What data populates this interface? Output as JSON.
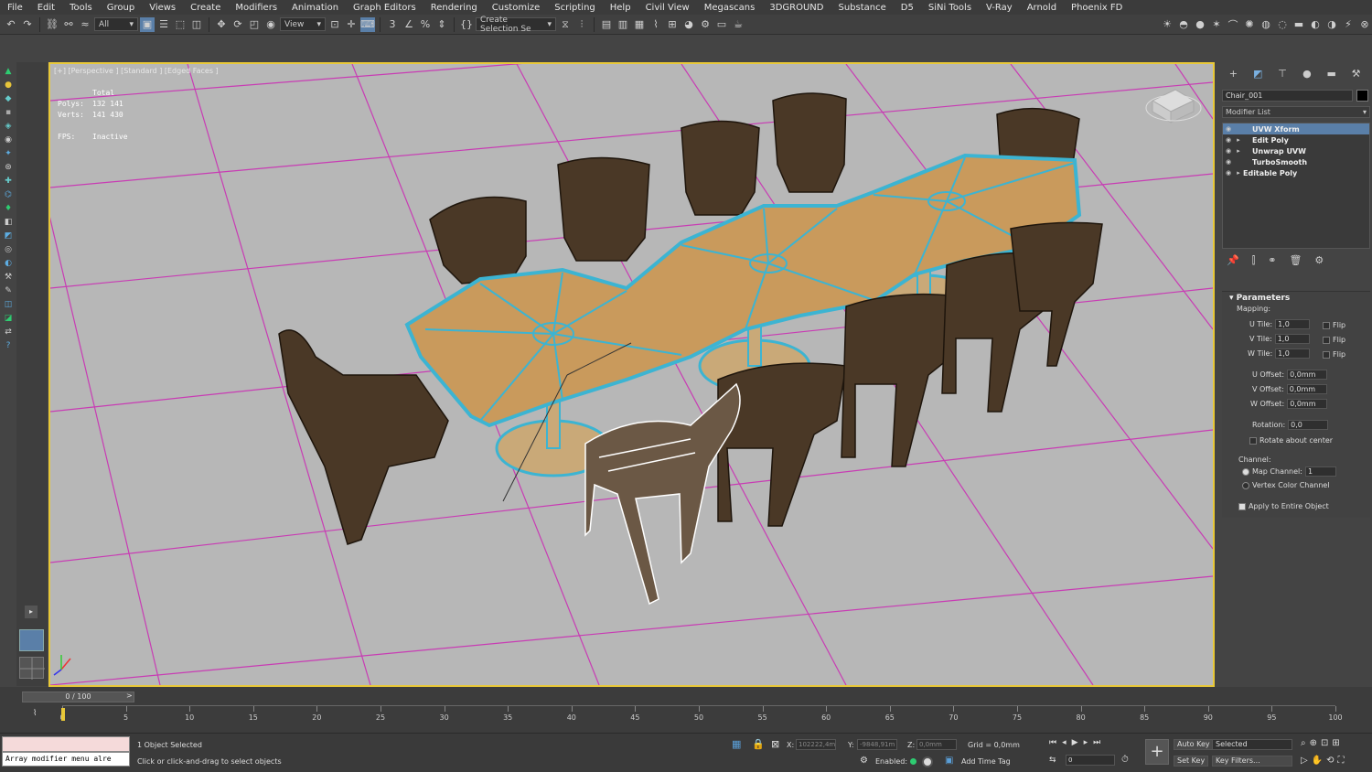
{
  "menu": [
    "File",
    "Edit",
    "Tools",
    "Group",
    "Views",
    "Create",
    "Modifiers",
    "Animation",
    "Graph Editors",
    "Rendering",
    "Customize",
    "Scripting",
    "Help",
    "Civil View",
    "Megascans",
    "3DGROUND",
    "Substance",
    "D5",
    "SiNi Tools",
    "V-Ray",
    "Arnold",
    "Phoenix FD"
  ],
  "toolbar": {
    "filter_dropdown": "All",
    "refcoord_dropdown": "View",
    "selection_set": "Create Selection Se"
  },
  "viewport": {
    "label": "[+] [Perspective ] [Standard ] [Edged Faces ]",
    "stats": [
      {
        "label": "",
        "value": "Total"
      },
      {
        "label": "Polys:",
        "value": "132 141"
      },
      {
        "label": "Verts:",
        "value": "141 430"
      }
    ],
    "fps_label": "FPS:",
    "fps_value": "Inactive"
  },
  "command_panel": {
    "object_name": "Chair_001",
    "modifier_list": "Modifier List",
    "stack": [
      {
        "label": "UVW Xform",
        "selected": true,
        "expandable": false
      },
      {
        "label": "Edit Poly",
        "selected": false,
        "expandable": true
      },
      {
        "label": "Unwrap UVW",
        "selected": false,
        "expandable": true
      },
      {
        "label": "TurboSmooth",
        "selected": false,
        "expandable": false
      },
      {
        "label": "Editable Poly",
        "selected": false,
        "expandable": true
      }
    ],
    "parameters": {
      "title": "Parameters",
      "mapping_label": "Mapping:",
      "u_tile_label": "U Tile:",
      "u_tile": "1,0",
      "v_tile_label": "V Tile:",
      "v_tile": "1,0",
      "w_tile_label": "W Tile:",
      "w_tile": "1,0",
      "flip_label": "Flip",
      "u_offset_label": "U Offset:",
      "u_offset": "0,0mm",
      "v_offset_label": "V Offset:",
      "v_offset": "0,0mm",
      "w_offset_label": "W Offset:",
      "w_offset": "0,0mm",
      "rotation_label": "Rotation:",
      "rotation": "0,0",
      "rotate_center_label": "Rotate about center",
      "channel_label": "Channel:",
      "map_channel_label": "Map Channel:",
      "map_channel": "1",
      "vertex_color_label": "Vertex Color Channel",
      "apply_entire_label": "Apply to Entire Object"
    }
  },
  "timeline": {
    "slider": "0 / 100",
    "ticks": [
      "0",
      "5",
      "10",
      "15",
      "20",
      "25",
      "30",
      "35",
      "40",
      "45",
      "50",
      "55",
      "60",
      "65",
      "70",
      "75",
      "80",
      "85",
      "90",
      "95",
      "100"
    ]
  },
  "status": {
    "listener": "Array modifier menu alre",
    "selected": "1 Object Selected",
    "prompt": "Click or click-and-drag to select objects",
    "x_label": "X:",
    "x_value": "102222,4m",
    "y_label": "Y:",
    "y_value": "-9848,91m",
    "z_label": "Z:",
    "z_value": "0,0mm",
    "grid": "Grid = 0,0mm",
    "enabled": "Enabled:",
    "add_time_tag": "Add Time Tag",
    "auto_key": "Auto Key",
    "selected_dropdown": "Selected",
    "set_key": "Set Key",
    "key_filters": "Key Filters...",
    "frame": "0"
  },
  "colors": {
    "viewport_bg": "#b7b7b7",
    "grid_line": "#c83cb4",
    "selected_wire": "#3cb4d2",
    "viewport_border": "#e8c838",
    "accent": "#5a7fa8"
  }
}
